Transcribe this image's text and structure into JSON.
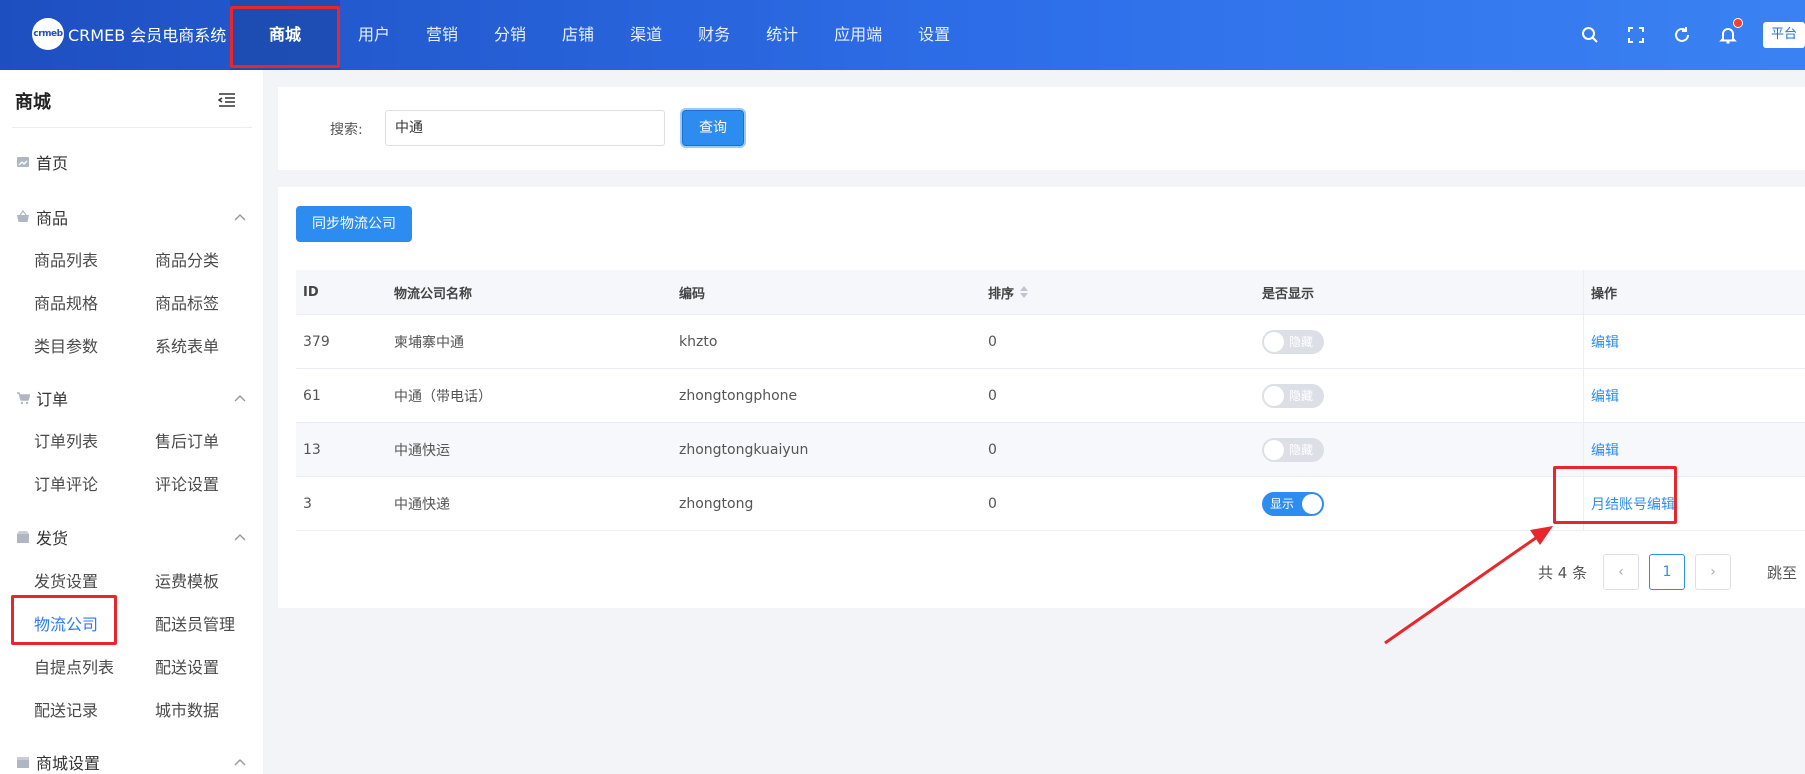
{
  "header": {
    "logo_badge": "crmeb",
    "logo_text": "CRMEB 会员电商系统",
    "nav": [
      "商城",
      "用户",
      "营销",
      "分销",
      "店铺",
      "渠道",
      "财务",
      "统计",
      "应用端",
      "设置"
    ],
    "active_nav": "商城",
    "platform_label": "平台"
  },
  "sidebar": {
    "title": "商城",
    "home": "首页",
    "groups": [
      {
        "label": "商品",
        "links": [
          "商品列表",
          "商品分类",
          "商品规格",
          "商品标签",
          "类目参数",
          "系统表单"
        ]
      },
      {
        "label": "订单",
        "links": [
          "订单列表",
          "售后订单",
          "订单评论",
          "评论设置"
        ]
      },
      {
        "label": "发货",
        "links": [
          "发货设置",
          "运费模板",
          "物流公司",
          "配送员管理",
          "自提点列表",
          "配送设置",
          "配送记录",
          "城市数据"
        ]
      },
      {
        "label": "商城设置",
        "links": []
      }
    ],
    "active_link": "物流公司"
  },
  "search": {
    "label": "搜索:",
    "value": "中通",
    "button": "查询"
  },
  "table": {
    "sync_button": "同步物流公司",
    "columns": {
      "id": "ID",
      "name": "物流公司名称",
      "code": "编码",
      "sort": "排序",
      "show": "是否显示",
      "op": "操作"
    },
    "rows": [
      {
        "id": "379",
        "name": "柬埔寨中通",
        "code": "khzto",
        "sort": "0",
        "show_label": "隐藏",
        "show_on": false,
        "op": "编辑"
      },
      {
        "id": "61",
        "name": "中通（带电话）",
        "code": "zhongtongphone",
        "sort": "0",
        "show_label": "隐藏",
        "show_on": false,
        "op": "编辑"
      },
      {
        "id": "13",
        "name": "中通快运",
        "code": "zhongtongkuaiyun",
        "sort": "0",
        "show_label": "隐藏",
        "show_on": false,
        "op": "编辑"
      },
      {
        "id": "3",
        "name": "中通快递",
        "code": "zhongtong",
        "sort": "0",
        "show_label": "显示",
        "show_on": true,
        "op": "月结账号编辑"
      }
    ]
  },
  "pagination": {
    "total": "共 4 条",
    "current_page": "1",
    "prev_icon": "‹",
    "next_icon": "›",
    "jump_label": "跳至"
  },
  "colors": {
    "accent": "#2d8cf0",
    "annotation": "#e8262b",
    "header_start": "#1e4fc1",
    "header_end": "#3a82f3"
  }
}
